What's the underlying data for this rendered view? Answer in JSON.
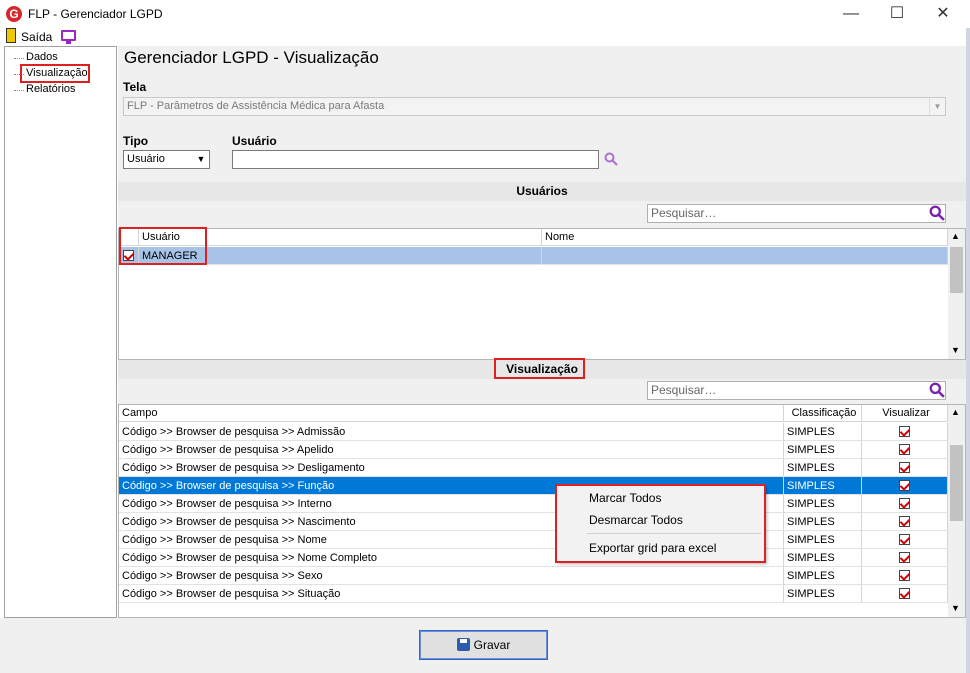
{
  "window": {
    "title": "FLP - Gerenciador LGPD",
    "app_icon_letter": "G",
    "minimize": "—",
    "maximize": "☐",
    "close": "✕"
  },
  "menu": {
    "exit_label": "Saída"
  },
  "sidebar": {
    "items": [
      {
        "label": "Dados"
      },
      {
        "label": "Visualização"
      },
      {
        "label": "Relatórios"
      }
    ]
  },
  "main": {
    "heading": "Gerenciador LGPD - Visualização",
    "tela_label": "Tela",
    "tela_value": "FLP - Parâmetros de Assistência Médica para Afasta",
    "tipo_label": "Tipo",
    "tipo_value": "Usuário",
    "usuario_label": "Usuário",
    "usuario_value": ""
  },
  "users_section": {
    "title": "Usuários",
    "search_placeholder": "Pesquisar…",
    "columns": [
      "Usuário",
      "Nome"
    ],
    "rows": [
      {
        "usuario": "MANAGER",
        "nome": ""
      }
    ]
  },
  "view_section": {
    "title": "Visualização",
    "search_placeholder": "Pesquisar…",
    "columns": [
      "Campo",
      "Classificação",
      "Visualizar"
    ],
    "rows": [
      {
        "campo": "Código >> Browser de pesquisa >> Admissão",
        "classificacao": "SIMPLES"
      },
      {
        "campo": "Código >> Browser de pesquisa >> Apelido",
        "classificacao": "SIMPLES"
      },
      {
        "campo": "Código >> Browser de pesquisa >> Desligamento",
        "classificacao": "SIMPLES"
      },
      {
        "campo": "Código >> Browser de pesquisa >> Função",
        "classificacao": "SIMPLES"
      },
      {
        "campo": "Código >> Browser de pesquisa >> Interno",
        "classificacao": "SIMPLES"
      },
      {
        "campo": "Código >> Browser de pesquisa >> Nascimento",
        "classificacao": "SIMPLES"
      },
      {
        "campo": "Código >> Browser de pesquisa >> Nome",
        "classificacao": "SIMPLES"
      },
      {
        "campo": "Código >> Browser de pesquisa >> Nome Completo",
        "classificacao": "SIMPLES"
      },
      {
        "campo": "Código >> Browser de pesquisa >> Sexo",
        "classificacao": "SIMPLES"
      },
      {
        "campo": "Código >> Browser de pesquisa >> Situação",
        "classificacao": "SIMPLES"
      }
    ]
  },
  "context_menu": {
    "items": [
      "Marcar Todos",
      "Desmarcar Todos",
      "Exportar grid para excel"
    ]
  },
  "footer": {
    "save_label": "Gravar"
  },
  "colors": {
    "selection": "#0078d7",
    "highlight": "#e02020",
    "accent": "#9b27c7"
  }
}
